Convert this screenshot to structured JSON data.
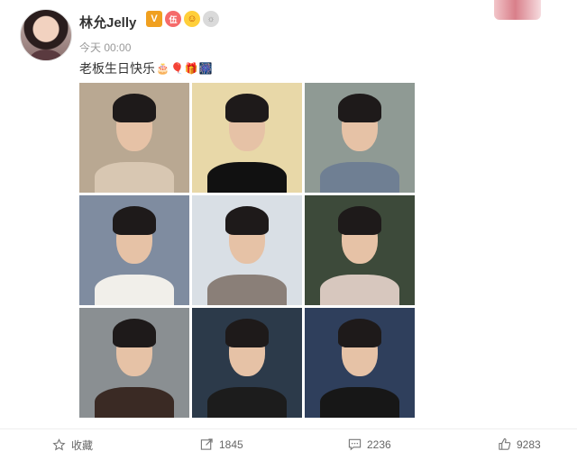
{
  "post": {
    "username": "林允Jelly",
    "badges": {
      "vip": "V",
      "level": "伍",
      "smile": "☺",
      "medal": "☼"
    },
    "timestamp": "今天 00:00",
    "text": "老板生日快乐",
    "emojis": [
      "🎂",
      "🎈",
      "🎁",
      "🎆"
    ]
  },
  "photos": [
    {
      "bg": "#b9a892",
      "body": "#d8c7b2"
    },
    {
      "bg": "#e8d8a8",
      "body": "#111111"
    },
    {
      "bg": "#8f9a94",
      "body": "#6f7f93"
    },
    {
      "bg": "#7f8ca0",
      "body": "#f1efea"
    },
    {
      "bg": "#d9dfe5",
      "body": "#8a7f78"
    },
    {
      "bg": "#3d4a3a",
      "body": "#d7c7be"
    },
    {
      "bg": "#8a8f92",
      "body": "#3a2a24"
    },
    {
      "bg": "#2c3a4a",
      "body": "#1c1c1c"
    },
    {
      "bg": "#2f3f5c",
      "body": "#171717"
    }
  ],
  "actions": {
    "favorite_label": "收藏",
    "repost_count": "1845",
    "comment_count": "2236",
    "like_count": "9283"
  }
}
